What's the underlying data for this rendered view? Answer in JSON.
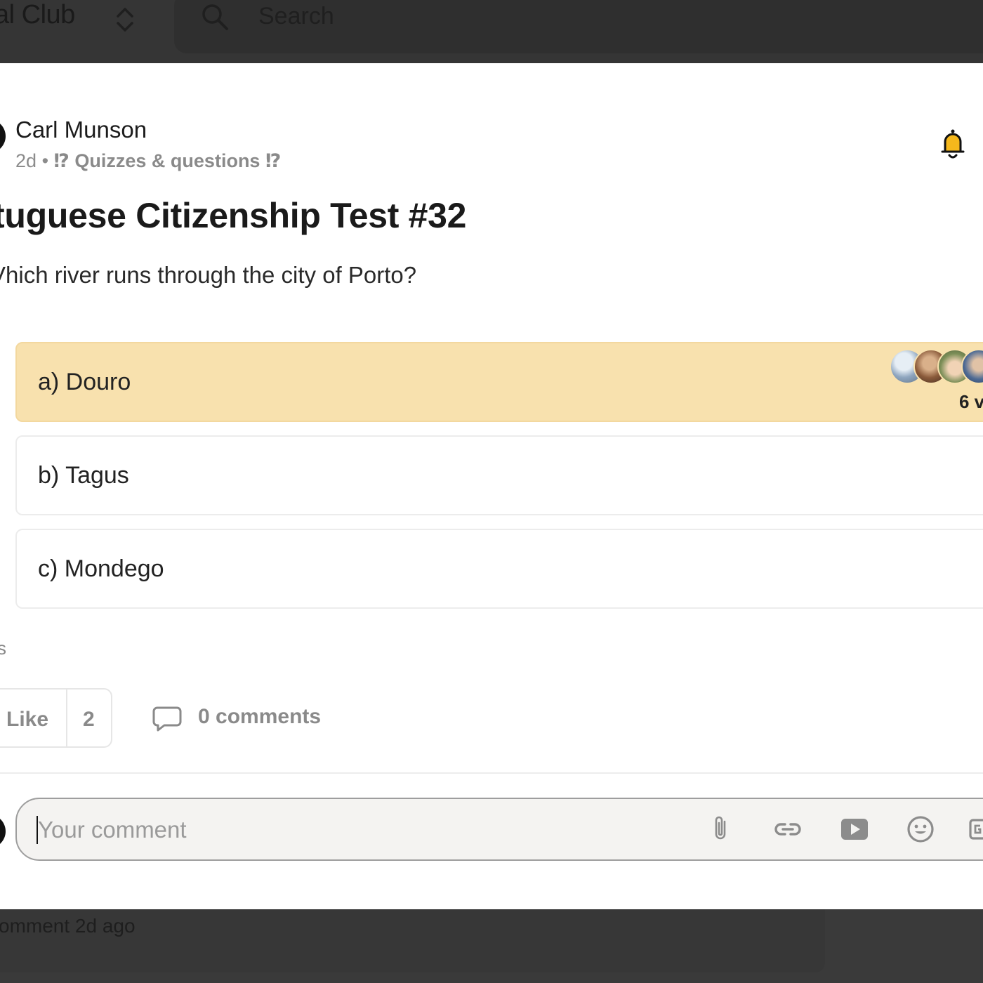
{
  "topbar": {
    "club_name": "al Club",
    "search_placeholder": "Search"
  },
  "post": {
    "author": "Carl Munson",
    "time": "2d",
    "separator": "•",
    "category": "⁉ Quizzes & questions ⁉",
    "title": "tuguese Citizenship Test #32",
    "question": "Vhich river runs through the city of Porto?"
  },
  "poll": {
    "options": [
      {
        "label": "a) Douro",
        "selected": true
      },
      {
        "label": "b) Tagus",
        "selected": false
      },
      {
        "label": "c) Mondego",
        "selected": false
      }
    ],
    "votes_text": "6 v",
    "truncated_label": "s"
  },
  "actions": {
    "like_label": "Like",
    "like_count": "2",
    "comments_label": "0 comments"
  },
  "comment_box": {
    "placeholder": "Your comment"
  },
  "background": {
    "last_activity": "omment 2d ago"
  },
  "colors": {
    "selected_option": "#f8e1ae",
    "avatar_badge": "#4553c9",
    "overlay_dark": "#353535"
  },
  "icons": [
    "chevron-updown-icon",
    "search-icon",
    "bell-icon",
    "comment-icon",
    "attachment-icon",
    "link-icon",
    "video-icon",
    "emoji-icon",
    "gif-icon"
  ]
}
